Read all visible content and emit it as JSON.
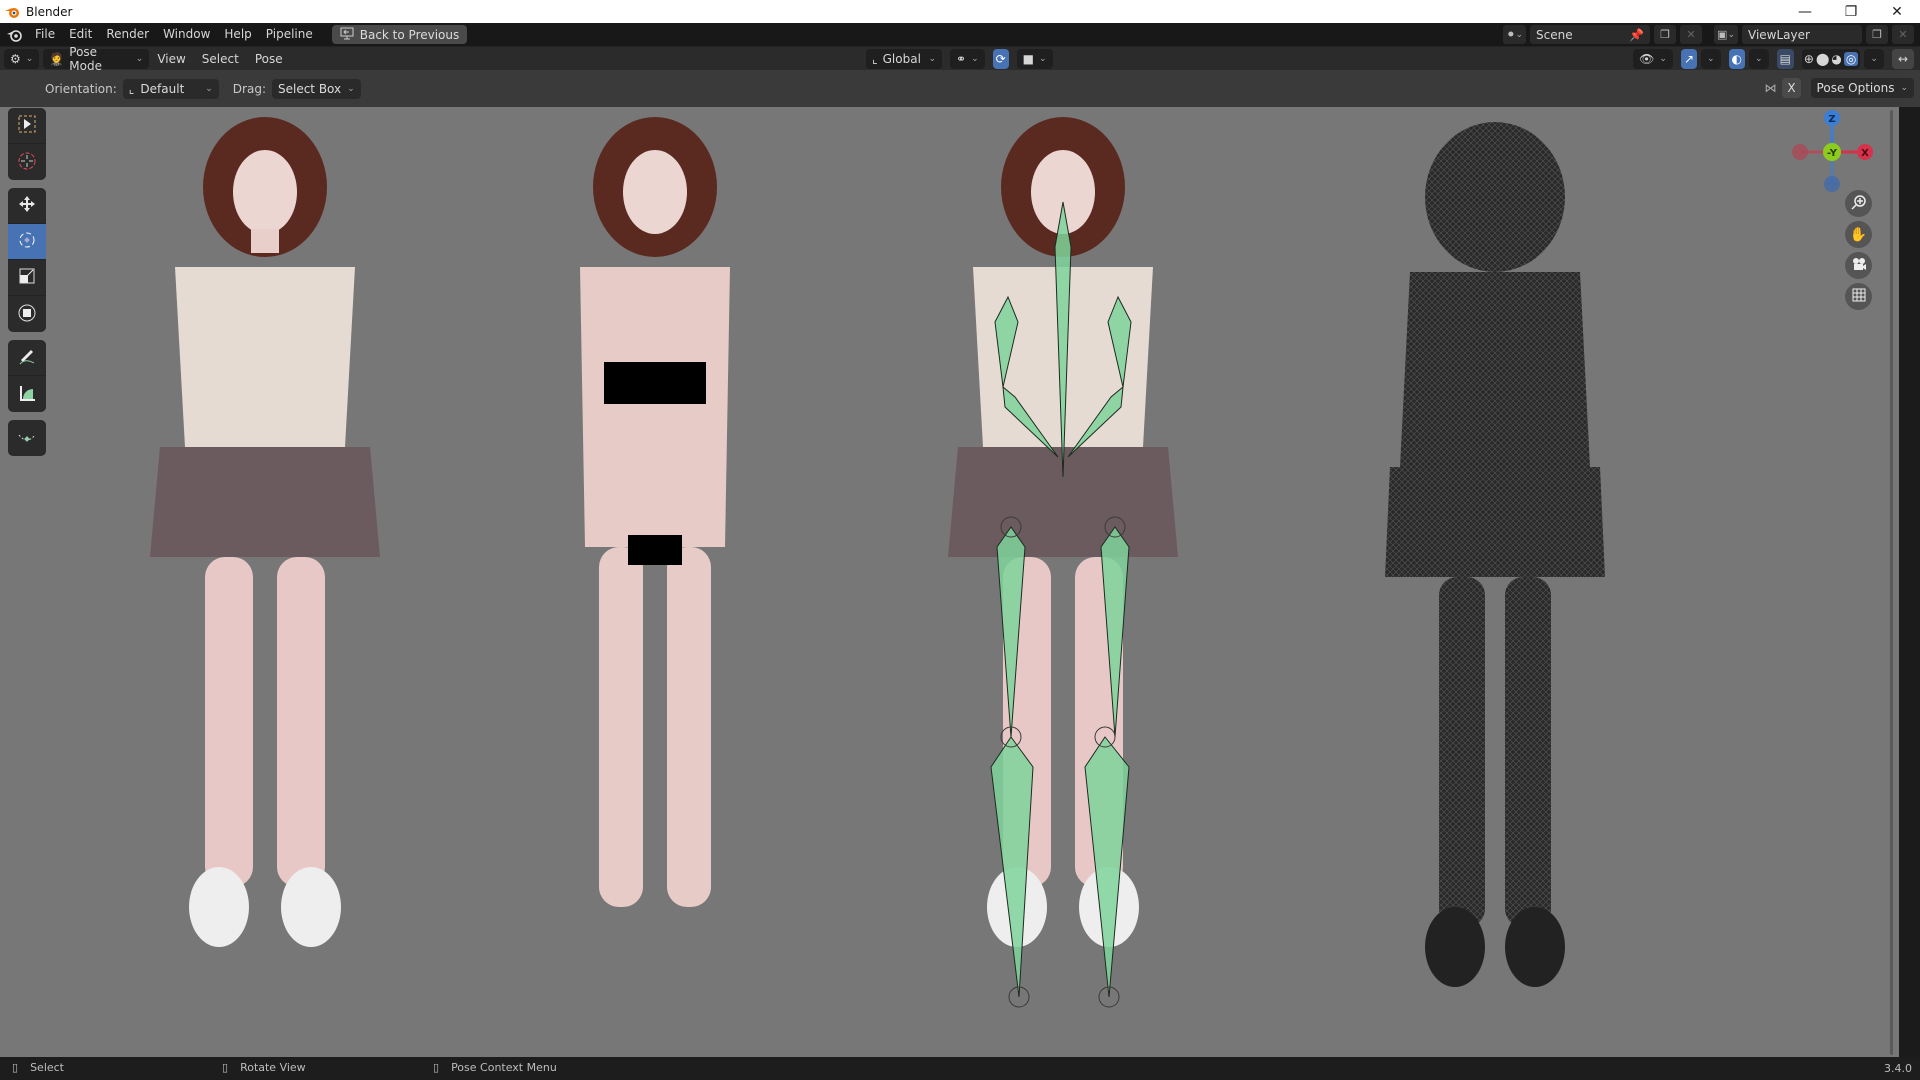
{
  "window": {
    "title": "Blender",
    "controls": [
      "minimize",
      "restore",
      "close"
    ]
  },
  "topbar": {
    "menus": [
      "File",
      "Edit",
      "Render",
      "Window",
      "Help",
      "Pipeline"
    ],
    "back_button": "Back to Previous",
    "scene": {
      "label": "Scene"
    },
    "view_layer": {
      "label": "ViewLayer"
    }
  },
  "header": {
    "mode": "Pose Mode",
    "menus": [
      "View",
      "Select",
      "Pose"
    ],
    "transform_orientation": "Global",
    "shading_active": "rendered"
  },
  "tool_settings": {
    "orientation_label": "Orientation:",
    "orientation_value": "Default",
    "drag_label": "Drag:",
    "drag_value": "Select Box",
    "pose_options": "Pose Options",
    "x_mirror": "X"
  },
  "toolbar": {
    "tools": [
      "select-box",
      "cursor",
      "move",
      "rotate",
      "scale",
      "transform",
      "annotate",
      "measure",
      "relax"
    ],
    "active": "rotate"
  },
  "gizmo": {
    "axes": {
      "z": "Z",
      "y": "-Y",
      "x": "X"
    },
    "colors": {
      "x": "#d6334a",
      "y": "#8ccc1e",
      "z": "#3a7ed6"
    }
  },
  "viewport": {
    "figures": [
      "clothed",
      "base-mesh-censored",
      "armature-overlay",
      "wireframe"
    ],
    "armature_color": "#7fd39a"
  },
  "statusbar": {
    "items": [
      "Select",
      "Rotate View",
      "Pose Context Menu"
    ],
    "version": "3.4.0"
  },
  "colors": {
    "accent": "#4772b3",
    "viewport_bg": "#777777",
    "header_bg": "#2b2b2b"
  }
}
